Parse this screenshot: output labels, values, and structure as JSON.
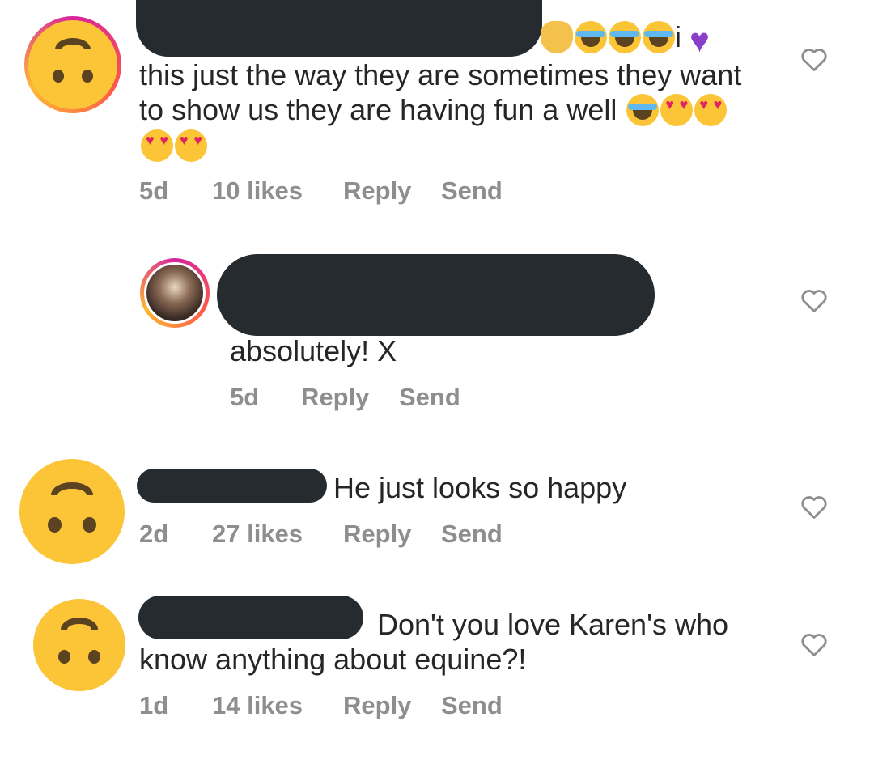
{
  "comments": [
    {
      "body_line1_suffix": "i",
      "body_line2": "this just the way they are sometimes they want",
      "body_line3": "to show us they are having fun a well",
      "age": "5d",
      "likes": "10 likes",
      "reply": "Reply",
      "send": "Send"
    },
    {
      "body": "absolutely! X",
      "age": "5d",
      "reply": "Reply",
      "send": "Send"
    },
    {
      "body": "He just looks so happy",
      "age": "2d",
      "likes": "27 likes",
      "reply": "Reply",
      "send": "Send"
    },
    {
      "body_line1": "Don't you love Karen's who",
      "body_line2": "know anything about equine?!",
      "age": "1d",
      "likes": "14 likes",
      "reply": "Reply",
      "send": "Send"
    }
  ],
  "icons": {
    "like": "heart-outline-icon",
    "avatar": "upside-down-face-emoji"
  },
  "colors": {
    "text": "#262626",
    "meta": "#8e8e8e",
    "avatar_yellow": "#FBC537",
    "redaction": "#262b30"
  }
}
